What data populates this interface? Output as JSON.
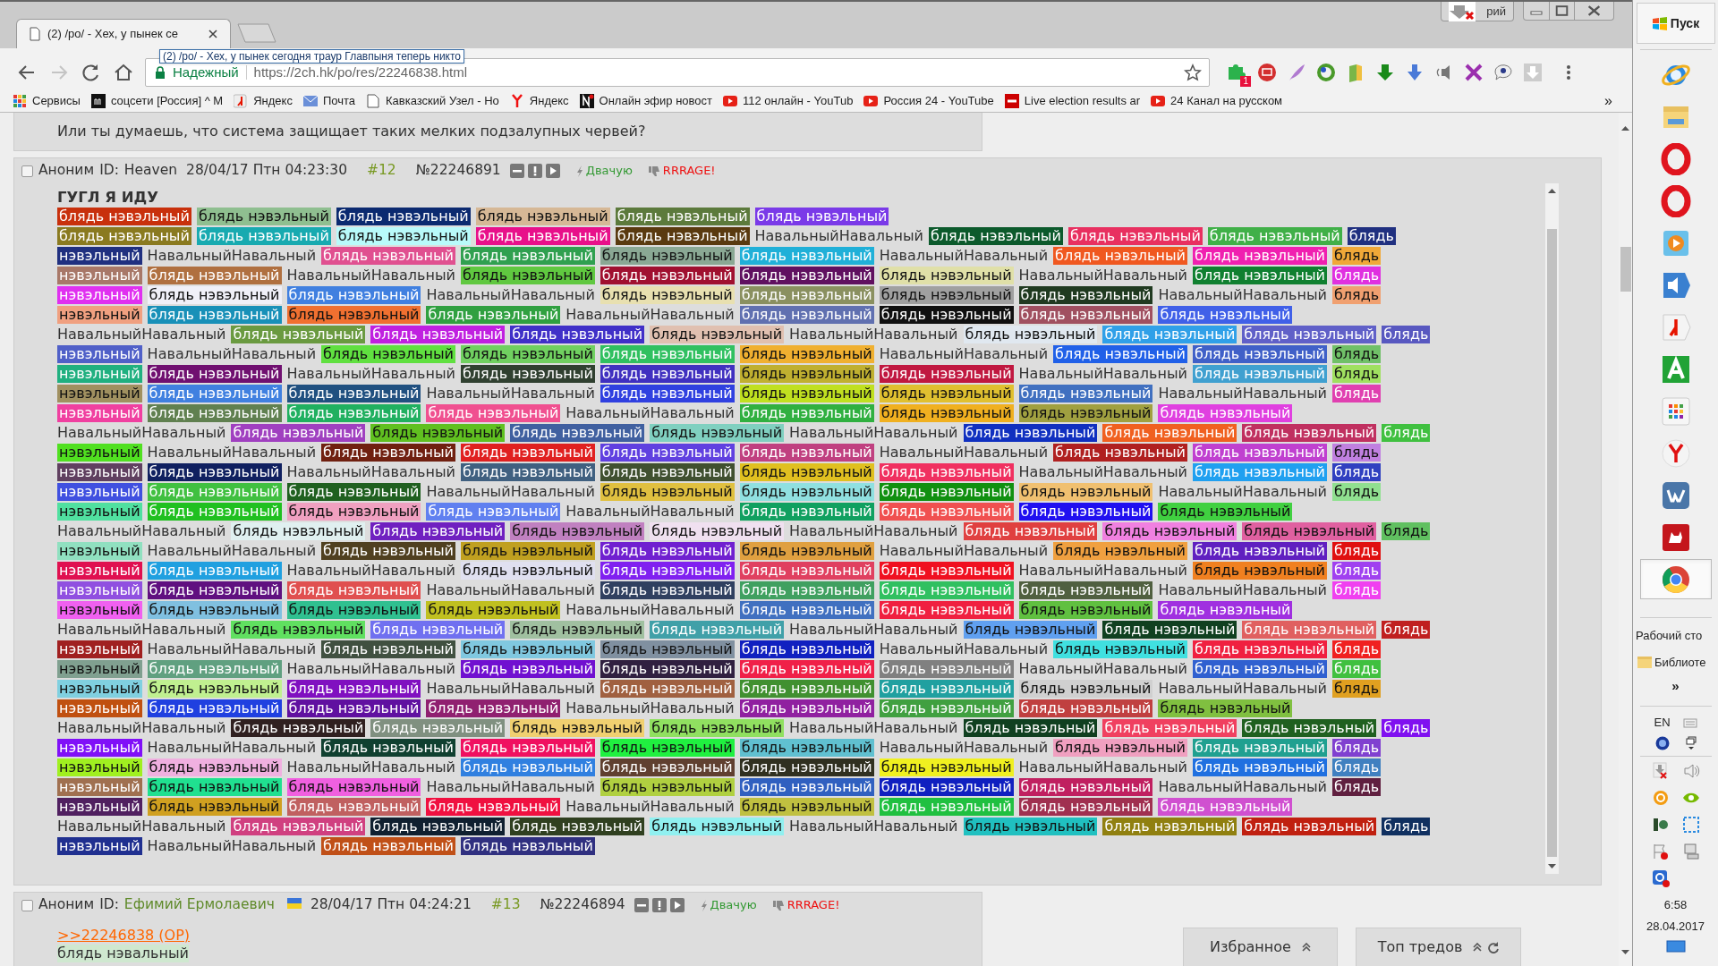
{
  "browser": {
    "tab_title": "(2) /po/ - Хех, у пынек се",
    "tooltip": "(2) /po/ - Хех, у пынек сегодня траур Главпыня теперь никто",
    "security_label": "Надежный",
    "url": "https://2ch.hk/po/res/22246838.html",
    "profile_name": "рий",
    "extension_badge": "1",
    "bookmarks": [
      {
        "label": "Сервисы"
      },
      {
        "label": "соцсети [Россия] ^ М"
      },
      {
        "label": "Яндекс"
      },
      {
        "label": "Почта"
      },
      {
        "label": "Кавказский Узел - Но"
      },
      {
        "label": "Яндекс"
      },
      {
        "label": "Онлайн эфир новост"
      },
      {
        "label": "112 онлайн - YouTub"
      },
      {
        "label": "Россия 24 - YouTube"
      },
      {
        "label": "Live election results ar"
      },
      {
        "label": "24 Канал на русском"
      }
    ],
    "bookmarks_more": "»"
  },
  "previous_post_text": "Или ты думаешь, что система защищает таких мелких подзалупных червей?",
  "posts": [
    {
      "checked": false,
      "author": "Аноним",
      "id_label": "ID:",
      "poster_id": "Heaven",
      "named_id": false,
      "flag": false,
      "date": "28/04/17 Птн 04:23:30",
      "number": "#12",
      "post_id": "№22246891",
      "like": "Двачую",
      "dislike": "RRRAGE!",
      "heading": "ГУГЛ Я ИДУ",
      "lines": [
        [
          {
            "text": "блядь нэвэльный",
            "color": "#c8300c"
          },
          {
            "text": "блядь нэвэльный",
            "color": "#8fbf90"
          },
          {
            "text": "блядь нэвэльный",
            "color": "#0b2a70"
          },
          {
            "text": "блядь нэвэльный",
            "color": "#d6b896"
          },
          {
            "text": "блядь нэвэльный",
            "color": "#5c7a3c"
          },
          {
            "text": "блядь нэвэльный",
            "color": "#7a3ae8"
          }
        ],
        [
          {
            "text": "блядь нэвэльный",
            "color": "#8a7a20"
          },
          {
            "text": "блядь нэвэльный",
            "color": "#18aab0"
          },
          {
            "text": "блядь нэвэльный",
            "color": "#b8fafa"
          },
          {
            "text": "блядь нэвэльный",
            "color": "#e8108a"
          },
          {
            "text": "блядь нэвэльный",
            "color": "#5a3a10"
          },
          {
            "text": "НавальныйНавальный"
          },
          {
            "text": "блядь нэвэльный",
            "color": "#0c5a2c"
          },
          {
            "text": "блядь нэвэльный",
            "color": "#e83060"
          },
          {
            "text": "блядь нэвэльный",
            "color": "#40b048"
          },
          {
            "text": "блядь",
            "color": "#203080"
          }
        ],
        [
          {
            "text": "нэвэльный",
            "color": "#203080"
          },
          {
            "text": "НавальныйНавальный"
          },
          {
            "text": "блядь нэвэльный",
            "color": "#e05090"
          },
          {
            "text": "блядь нэвэльный",
            "color": "#30a050"
          },
          {
            "text": "блядь нэвэльный",
            "color": "#8aa894"
          },
          {
            "text": "блядь нэвэльный",
            "color": "#20b0d8"
          },
          {
            "text": "НавальныйНавальный"
          },
          {
            "text": "блядь нэвэльный",
            "color": "#f05820"
          },
          {
            "text": "блядь нэвэльный",
            "color": "#f020b0"
          },
          {
            "text": "блядь",
            "color": "#f0a838"
          }
        ],
        [
          {
            "text": "нэвэльный",
            "color": "#a87868"
          },
          {
            "text": "блядь нэвэльный",
            "color": "#b07040"
          },
          {
            "text": "НавальныйНавальный"
          },
          {
            "text": "блядь нэвэльный",
            "color": "#60c840"
          },
          {
            "text": "блядь нэвэльный",
            "color": "#a01030"
          },
          {
            "text": "блядь нэвэльный",
            "color": "#601060"
          },
          {
            "text": "блядь нэвэльный",
            "color": "#e0e0a8"
          },
          {
            "text": "НавальныйНавальный"
          },
          {
            "text": "блядь нэвэльный",
            "color": "#108030"
          },
          {
            "text": "блядь",
            "color": "#e030e0"
          }
        ],
        [
          {
            "text": "нэвэльный",
            "color": "#e030f0"
          },
          {
            "text": "блядь нэвэльный",
            "color": "#f0f0f8"
          },
          {
            "text": "блядь нэвэльный",
            "color": "#4080e0"
          },
          {
            "text": "НавальныйНавальный"
          },
          {
            "text": "блядь нэвэльный",
            "color": "#e8e0b0"
          },
          {
            "text": "блядь нэвэльный",
            "color": "#8a9060"
          },
          {
            "text": "блядь нэвэльный",
            "color": "#a0a0a0"
          },
          {
            "text": "блядь нэвэльный",
            "color": "#203a20"
          },
          {
            "text": "НавальныйНавальный"
          },
          {
            "text": "блядь",
            "color": "#f0a070"
          }
        ],
        [
          {
            "text": "нэвэльный",
            "color": "#f0a080"
          },
          {
            "text": "блядь нэвэльный",
            "color": "#1890b8"
          },
          {
            "text": "блядь нэвэльный",
            "color": "#f07030"
          },
          {
            "text": "блядь нэвэльный",
            "color": "#30a040"
          },
          {
            "text": "НавальныйНавальный"
          },
          {
            "text": "блядь нэвэльный",
            "color": "#6070b0"
          },
          {
            "text": "блядь нэвэльный",
            "color": "#101010"
          },
          {
            "text": "блядь нэвэльный",
            "color": "#a05060"
          },
          {
            "text": "блядь нэвэльный",
            "color": "#4060e8"
          }
        ],
        [
          {
            "text": "НавальныйНавальный"
          },
          {
            "text": "блядь нэвэльный",
            "color": "#6a9a40"
          },
          {
            "text": "блядь нэвэльный",
            "color": "#c020e0"
          },
          {
            "text": "блядь нэвэльный",
            "color": "#4030c8"
          },
          {
            "text": "блядь нэвэльный",
            "color": "#e0c0b0"
          },
          {
            "text": "НавальныйНавальный"
          },
          {
            "text": "блядь нэвэльный",
            "color": "#e0e8f0"
          },
          {
            "text": "блядь нэвэльный",
            "color": "#30a0e8"
          },
          {
            "text": "блядь нэвэльный",
            "color": "#6060c8"
          },
          {
            "text": "блядь",
            "color": "#5858c0"
          }
        ],
        [
          {
            "text": "нэвэльный",
            "color": "#5060c8"
          },
          {
            "text": "НавальныйНавальный"
          },
          {
            "text": "блядь нэвэльный",
            "color": "#60e040"
          },
          {
            "text": "блядь нэвэльный",
            "color": "#70d060"
          },
          {
            "text": "блядь нэвэльный",
            "color": "#30c060"
          },
          {
            "text": "блядь нэвэльный",
            "color": "#f0b030"
          },
          {
            "text": "НавальныйНавальный"
          },
          {
            "text": "блядь нэвэльный",
            "color": "#2060e8"
          },
          {
            "text": "блядь нэвэльный",
            "color": "#4060c8"
          },
          {
            "text": "блядь",
            "color": "#70c068"
          }
        ],
        [
          {
            "text": "нэвэльный",
            "color": "#20b080"
          },
          {
            "text": "блядь нэвэльный",
            "color": "#701070"
          },
          {
            "text": "НавальныйНавальный"
          },
          {
            "text": "блядь нэвэльный",
            "color": "#304030"
          },
          {
            "text": "блядь нэвэльный",
            "color": "#4030c0"
          },
          {
            "text": "блядь нэвэльный",
            "color": "#c0b030"
          },
          {
            "text": "блядь нэвэльный",
            "color": "#c01840"
          },
          {
            "text": "НавальныйНавальный"
          },
          {
            "text": "блядь нэвэльный",
            "color": "#40a0d0"
          },
          {
            "text": "блядь",
            "color": "#a0e060"
          }
        ],
        [
          {
            "text": "нэвэльный",
            "color": "#a09060"
          },
          {
            "text": "блядь нэвэльный",
            "color": "#4080e0"
          },
          {
            "text": "блядь нэвэльный",
            "color": "#205080"
          },
          {
            "text": "НавальныйНавальный"
          },
          {
            "text": "блядь нэвэльный",
            "color": "#3040e0"
          },
          {
            "text": "блядь нэвэльный",
            "color": "#c0e020"
          },
          {
            "text": "блядь нэвэльный",
            "color": "#e0c030"
          },
          {
            "text": "блядь нэвэльный",
            "color": "#4070c0"
          },
          {
            "text": "НавальныйНавальный"
          },
          {
            "text": "блядь",
            "color": "#e040b0"
          }
        ],
        [
          {
            "text": "нэвэльный",
            "color": "#f040a0"
          },
          {
            "text": "блядь нэвэльный",
            "color": "#608050"
          },
          {
            "text": "блядь нэвэльный",
            "color": "#20b060"
          },
          {
            "text": "блядь нэвэльный",
            "color": "#f05090"
          },
          {
            "text": "НавальныйНавальный"
          },
          {
            "text": "блядь нэвэльный",
            "color": "#30b040"
          },
          {
            "text": "блядь нэвэльный",
            "color": "#f0b020"
          },
          {
            "text": "блядь нэвэльный",
            "color": "#a0a040"
          },
          {
            "text": "блядь нэвэльный",
            "color": "#e040e0"
          }
        ],
        [
          {
            "text": "НавальныйНавальный"
          },
          {
            "text": "блядь нэвэльный",
            "color": "#a040c0"
          },
          {
            "text": "блядь нэвэльный",
            "color": "#60c020"
          },
          {
            "text": "блядь нэвэльный",
            "color": "#4060a0"
          },
          {
            "text": "блядь нэвэльный",
            "color": "#80d0c0"
          },
          {
            "text": "НавальныйНавальный"
          },
          {
            "text": "блядь нэвэльный",
            "color": "#1030c0"
          },
          {
            "text": "блядь нэвэльный",
            "color": "#f06020"
          },
          {
            "text": "блядь нэвэльный",
            "color": "#c03060"
          },
          {
            "text": "блядь",
            "color": "#40c040"
          }
        ],
        [
          {
            "text": "нэвэльный",
            "color": "#50e020"
          },
          {
            "text": "НавальныйНавальный"
          },
          {
            "text": "блядь нэвэльный",
            "color": "#702010"
          },
          {
            "text": "блядь нэвэльный",
            "color": "#e02020"
          },
          {
            "text": "блядь нэвэльный",
            "color": "#6040e0"
          },
          {
            "text": "блядь нэвэльный",
            "color": "#c04080"
          },
          {
            "text": "НавальныйНавальный"
          },
          {
            "text": "блядь нэвэльный",
            "color": "#b02020"
          },
          {
            "text": "блядь нэвэльный",
            "color": "#c040d0"
          },
          {
            "text": "блядь",
            "color": "#c080e0"
          }
        ],
        [
          {
            "text": "нэвэльный",
            "color": "#604060"
          },
          {
            "text": "блядь нэвэльный",
            "color": "#102060"
          },
          {
            "text": "НавальныйНавальный"
          },
          {
            "text": "блядь нэвэльный",
            "color": "#406080"
          },
          {
            "text": "блядь нэвэльный",
            "color": "#405030"
          },
          {
            "text": "блядь нэвэльный",
            "color": "#e0c020"
          },
          {
            "text": "блядь нэвэльный",
            "color": "#f03060"
          },
          {
            "text": "НавальныйНавальный"
          },
          {
            "text": "блядь нэвэльный",
            "color": "#20a0f0"
          },
          {
            "text": "блядь",
            "color": "#3040c0"
          }
        ],
        [
          {
            "text": "нэвэльный",
            "color": "#4050e0"
          },
          {
            "text": "блядь нэвэльный",
            "color": "#40c040"
          },
          {
            "text": "блядь нэвэльный",
            "color": "#206020"
          },
          {
            "text": "НавальныйНавальный"
          },
          {
            "text": "блядь нэвэльный",
            "color": "#e0c040"
          },
          {
            "text": "блядь нэвэльный",
            "color": "#90e0e0"
          },
          {
            "text": "блядь нэвэльный",
            "color": "#109010"
          },
          {
            "text": "блядь нэвэльный",
            "color": "#f0c070"
          },
          {
            "text": "НавальныйНавальный"
          },
          {
            "text": "блядь",
            "color": "#90e090"
          }
        ],
        [
          {
            "text": "нэвэльный",
            "color": "#50e0a0"
          },
          {
            "text": "блядь нэвэльный",
            "color": "#20c020"
          },
          {
            "text": "блядь нэвэльный",
            "color": "#f0a0c0"
          },
          {
            "text": "блядь нэвэльный",
            "color": "#6080f0"
          },
          {
            "text": "НавальныйНавальный"
          },
          {
            "text": "блядь нэвэльный",
            "color": "#10a060"
          },
          {
            "text": "блядь нэвэльный",
            "color": "#f05050"
          },
          {
            "text": "блядь нэвэльный",
            "color": "#2010f0"
          },
          {
            "text": "блядь нэвэльный",
            "color": "#40d040"
          }
        ],
        [
          {
            "text": "НавальныйНавальный"
          },
          {
            "text": "блядь нэвэльный",
            "color": "#e0f0f0"
          },
          {
            "text": "блядь нэвэльный",
            "color": "#7020c0"
          },
          {
            "text": "блядь нэвэльный",
            "color": "#c080c0"
          },
          {
            "text": "блядь нэвэльный",
            "color": "#f0e0f0"
          },
          {
            "text": "НавальныйНавальный"
          },
          {
            "text": "блядь нэвэльный",
            "color": "#e04040"
          },
          {
            "text": "блядь нэвэльный",
            "color": "#f080e0"
          },
          {
            "text": "блядь нэвэльный",
            "color": "#e060a0"
          },
          {
            "text": "блядь",
            "color": "#60c060"
          }
        ],
        [
          {
            "text": "нэвэльный",
            "color": "#90e0c0"
          },
          {
            "text": "НавальныйНавальный"
          },
          {
            "text": "блядь нэвэльный",
            "color": "#504020"
          },
          {
            "text": "блядь нэвэльный",
            "color": "#c0a020"
          },
          {
            "text": "блядь нэвэльный",
            "color": "#7020d0"
          },
          {
            "text": "блядь нэвэльный",
            "color": "#e0a040"
          },
          {
            "text": "НавальныйНавальный"
          },
          {
            "text": "блядь нэвэльный",
            "color": "#f0a040"
          },
          {
            "text": "блядь нэвэльный",
            "color": "#6020c0"
          },
          {
            "text": "блядь",
            "color": "#e01010"
          }
        ],
        [
          {
            "text": "нэвэльный",
            "color": "#e01050"
          },
          {
            "text": "блядь нэвэльный",
            "color": "#20a0e0"
          },
          {
            "text": "НавальныйНавальный"
          },
          {
            "text": "блядь нэвэльный",
            "color": "#e0e0f0"
          },
          {
            "text": "блядь нэвэльный",
            "color": "#8020f0"
          },
          {
            "text": "блядь нэвэльный",
            "color": "#e04060"
          },
          {
            "text": "блядь нэвэльный",
            "color": "#f01020"
          },
          {
            "text": "НавальныйНавальный"
          },
          {
            "text": "блядь нэвэльный",
            "color": "#f08020"
          },
          {
            "text": "блядь",
            "color": "#a040f0"
          }
        ],
        [
          {
            "text": "нэвэльный",
            "color": "#9050e0"
          },
          {
            "text": "блядь нэвэльный",
            "color": "#601080"
          },
          {
            "text": "блядь нэвэльный",
            "color": "#e05050"
          },
          {
            "text": "НавальныйНавальный"
          },
          {
            "text": "блядь нэвэльный",
            "color": "#304060"
          },
          {
            "text": "блядь нэвэльный",
            "color": "#40a060"
          },
          {
            "text": "блядь нэвэльный",
            "color": "#30c060"
          },
          {
            "text": "блядь нэвэльный",
            "color": "#506040"
          },
          {
            "text": "НавальныйНавальный"
          },
          {
            "text": "блядь",
            "color": "#f040f0"
          }
        ],
        [
          {
            "text": "нэвэльный",
            "color": "#f060f0"
          },
          {
            "text": "блядь нэвэльный",
            "color": "#80c0e0"
          },
          {
            "text": "блядь нэвэльный",
            "color": "#30c090"
          },
          {
            "text": "блядь нэвэльный",
            "color": "#c0c020"
          },
          {
            "text": "НавальныйНавальный"
          },
          {
            "text": "блядь нэвэльный",
            "color": "#4070c0"
          },
          {
            "text": "блядь нэвэльный",
            "color": "#f02040"
          },
          {
            "text": "блядь нэвэльный",
            "color": "#60c040"
          },
          {
            "text": "блядь нэвэльный",
            "color": "#a030e0"
          }
        ],
        [
          {
            "text": "НавальныйНавальный"
          },
          {
            "text": "блядь нэвэльный",
            "color": "#60e060"
          },
          {
            "text": "блядь нэвэльный",
            "color": "#7070f0"
          },
          {
            "text": "блядь нэвэльный",
            "color": "#a0c0a0"
          },
          {
            "text": "блядь нэвэльный",
            "color": "#40a0a8"
          },
          {
            "text": "НавальныйНавальный"
          },
          {
            "text": "блядь нэвэльный",
            "color": "#60a0f0"
          },
          {
            "text": "блядь нэвэльный",
            "color": "#104020"
          },
          {
            "text": "блядь нэвэльный",
            "color": "#e06060"
          },
          {
            "text": "блядь",
            "color": "#c02020"
          }
        ],
        [
          {
            "text": "нэвэльный",
            "color": "#a02020"
          },
          {
            "text": "НавальныйНавальный"
          },
          {
            "text": "блядь нэвэльный",
            "color": "#405040"
          },
          {
            "text": "блядь нэвэльный",
            "color": "#80c8e0"
          },
          {
            "text": "блядь нэвэльный",
            "color": "#8090a0"
          },
          {
            "text": "блядь нэвэльный",
            "color": "#1020c0"
          },
          {
            "text": "НавальныйНавальный"
          },
          {
            "text": "блядь нэвэльный",
            "color": "#40e0e0"
          },
          {
            "text": "блядь нэвэльный",
            "color": "#f02040"
          },
          {
            "text": "блядь",
            "color": "#f02020"
          }
        ],
        [
          {
            "text": "нэвэльный",
            "color": "#80a090"
          },
          {
            "text": "блядь нэвэльный",
            "color": "#60a080"
          },
          {
            "text": "НавальныйНавальный"
          },
          {
            "text": "блядь нэвэльный",
            "color": "#7010d0"
          },
          {
            "text": "блядь нэвэльный",
            "color": "#302040"
          },
          {
            "text": "блядь нэвэльный",
            "color": "#f02048"
          },
          {
            "text": "блядь нэвэльный",
            "color": "#808080"
          },
          {
            "text": "НавальныйНавальный"
          },
          {
            "text": "блядь нэвэльный",
            "color": "#3060d0"
          },
          {
            "text": "блядь",
            "color": "#40c040"
          }
        ],
        [
          {
            "text": "нэвэльный",
            "color": "#80d0e0"
          },
          {
            "text": "блядь нэвэльный",
            "color": "#c0f090"
          },
          {
            "text": "блядь нэвэльный",
            "color": "#8010c0"
          },
          {
            "text": "НавальныйНавальный"
          },
          {
            "text": "блядь нэвэльный",
            "color": "#a06040"
          },
          {
            "text": "блядь нэвэльный",
            "color": "#409030"
          },
          {
            "text": "блядь нэвэльный",
            "color": "#20a0a0"
          },
          {
            "text": "блядь нэвэльный",
            "color": "#d0d0d0"
          },
          {
            "text": "НавальныйНавальный"
          },
          {
            "text": "блядь",
            "color": "#e0a020"
          }
        ],
        [
          {
            "text": "нэвэльный",
            "color": "#c05010"
          },
          {
            "text": "блядь нэвэльный",
            "color": "#2040e0"
          },
          {
            "text": "блядь нэвэльный",
            "color": "#6010a0"
          },
          {
            "text": "блядь нэвэльный",
            "color": "#902070"
          },
          {
            "text": "НавальныйНавальный"
          },
          {
            "text": "блядь нэвэльный",
            "color": "#9020a0"
          },
          {
            "text": "блядь нэвэльный",
            "color": "#40a040"
          },
          {
            "text": "блядь нэвэльный",
            "color": "#c04040"
          },
          {
            "text": "блядь нэвэльный",
            "color": "#80c040"
          }
        ],
        [
          {
            "text": "НавальныйНавальный"
          },
          {
            "text": "блядь нэвэльный",
            "color": "#302020"
          },
          {
            "text": "блядь нэвэльный",
            "color": "#809080"
          },
          {
            "text": "блядь нэвэльный",
            "color": "#f0d070"
          },
          {
            "text": "блядь нэвэльный",
            "color": "#90e060"
          },
          {
            "text": "НавальныйНавальный"
          },
          {
            "text": "блядь нэвэльный",
            "color": "#104020"
          },
          {
            "text": "блядь нэвэльный",
            "color": "#f04060"
          },
          {
            "text": "блядь нэвэльный",
            "color": "#206020"
          },
          {
            "text": "блядь",
            "color": "#8010f0"
          }
        ],
        [
          {
            "text": "нэвэльный",
            "color": "#8010f8"
          },
          {
            "text": "НавальныйНавальный"
          },
          {
            "text": "блядь нэвэльный",
            "color": "#104030"
          },
          {
            "text": "блядь нэвэльный",
            "color": "#f01060"
          },
          {
            "text": "блядь нэвэльный",
            "color": "#20f040"
          },
          {
            "text": "блядь нэвэльный",
            "color": "#60c0d0"
          },
          {
            "text": "НавальныйНавальный"
          },
          {
            "text": "блядь нэвэльный",
            "color": "#f0a0c0"
          },
          {
            "text": "блядь нэвэльный",
            "color": "#20a090"
          },
          {
            "text": "блядь",
            "color": "#8040d0"
          }
        ],
        [
          {
            "text": "нэвэльный",
            "color": "#a0f020"
          },
          {
            "text": "блядь нэвэльный",
            "color": "#f0b0e0"
          },
          {
            "text": "НавальныйНавальный"
          },
          {
            "text": "блядь нэвэльный",
            "color": "#3080e0"
          },
          {
            "text": "блядь нэвэльный",
            "color": "#604030"
          },
          {
            "text": "блядь нэвэльный",
            "color": "#303020"
          },
          {
            "text": "блядь нэвэльный",
            "color": "#f0f020"
          },
          {
            "text": "НавальныйНавальный"
          },
          {
            "text": "блядь нэвэльный",
            "color": "#2070e0"
          },
          {
            "text": "блядь",
            "color": "#4080c0"
          }
        ],
        [
          {
            "text": "нэвэльный",
            "color": "#a07050"
          },
          {
            "text": "блядь нэвэльный",
            "color": "#20e090"
          },
          {
            "text": "блядь нэвэльный",
            "color": "#f060e0"
          },
          {
            "text": "НавальныйНавальный"
          },
          {
            "text": "блядь нэвэльный",
            "color": "#b0d040"
          },
          {
            "text": "блядь нэвэльный",
            "color": "#3060c0"
          },
          {
            "text": "блядь нэвэльный",
            "color": "#1020c0"
          },
          {
            "text": "блядь нэвэльный",
            "color": "#c02060"
          },
          {
            "text": "НавальныйНавальный"
          },
          {
            "text": "блядь",
            "color": "#602040"
          }
        ],
        [
          {
            "text": "нэвэльный",
            "color": "#502060"
          },
          {
            "text": "блядь нэвэльный",
            "color": "#d0a020"
          },
          {
            "text": "блядь нэвэльный",
            "color": "#c06060"
          },
          {
            "text": "блядь нэвэльный",
            "color": "#f01040"
          },
          {
            "text": "НавальныйНавальный"
          },
          {
            "text": "блядь нэвэльный",
            "color": "#c0c040"
          },
          {
            "text": "блядь нэвэльный",
            "color": "#20c040"
          },
          {
            "text": "блядь нэвэльный",
            "color": "#a03050"
          },
          {
            "text": "блядь нэвэльный",
            "color": "#d050d0"
          }
        ],
        [
          {
            "text": "НавальныйНавальный"
          },
          {
            "text": "блядь нэвэльный",
            "color": "#d04080"
          },
          {
            "text": "блядь нэвэльный",
            "color": "#102030"
          },
          {
            "text": "блядь нэвэльный",
            "color": "#304020"
          },
          {
            "text": "блядь нэвэльный",
            "color": "#90f0f0"
          },
          {
            "text": "НавальныйНавальный"
          },
          {
            "text": "блядь нэвэльный",
            "color": "#20c0c0"
          },
          {
            "text": "блядь нэвэльный",
            "color": "#908010"
          },
          {
            "text": "блядь нэвэльный",
            "color": "#c02010"
          },
          {
            "text": "блядь",
            "color": "#103060"
          }
        ],
        [
          {
            "text": "нэвэльный",
            "color": "#203090"
          },
          {
            "text": "НавальныйНавальный"
          },
          {
            "text": "блядь нэвэльный",
            "color": "#c05018"
          },
          {
            "text": "блядь нэвэльный",
            "color": "#303080"
          }
        ]
      ]
    },
    {
      "checked": false,
      "author": "Аноним",
      "id_label": "ID:",
      "poster_id": "Ефимий Ермолаевич",
      "named_id": true,
      "flag": true,
      "date": "28/04/17 Птн 04:24:21",
      "number": "#13",
      "post_id": "№22246894",
      "like": "Двачую",
      "dislike": "RRRAGE!",
      "reply_link": ">>22246838 (OP)",
      "first_line": "блядь нэвальный"
    }
  ],
  "floating_buttons": [
    {
      "label": "Избранное",
      "refresh": false
    },
    {
      "label": "Топ тредов",
      "refresh": true
    }
  ],
  "taskbar": {
    "start": "Пуск",
    "apps": [
      {
        "selected": false
      },
      {
        "selected": false
      },
      {
        "selected": false
      },
      {
        "selected": false
      },
      {
        "selected": false
      },
      {
        "selected": false
      },
      {
        "selected": false
      },
      {
        "selected": false
      },
      {
        "selected": false
      },
      {
        "selected": false
      },
      {
        "selected": false
      },
      {
        "selected": false
      },
      {
        "selected": true
      }
    ],
    "desktop_toolbar": "Рабочий сто",
    "library": "Библиоте",
    "more": "»",
    "language": "EN",
    "time": "6:58",
    "date": "28.04.2017"
  }
}
